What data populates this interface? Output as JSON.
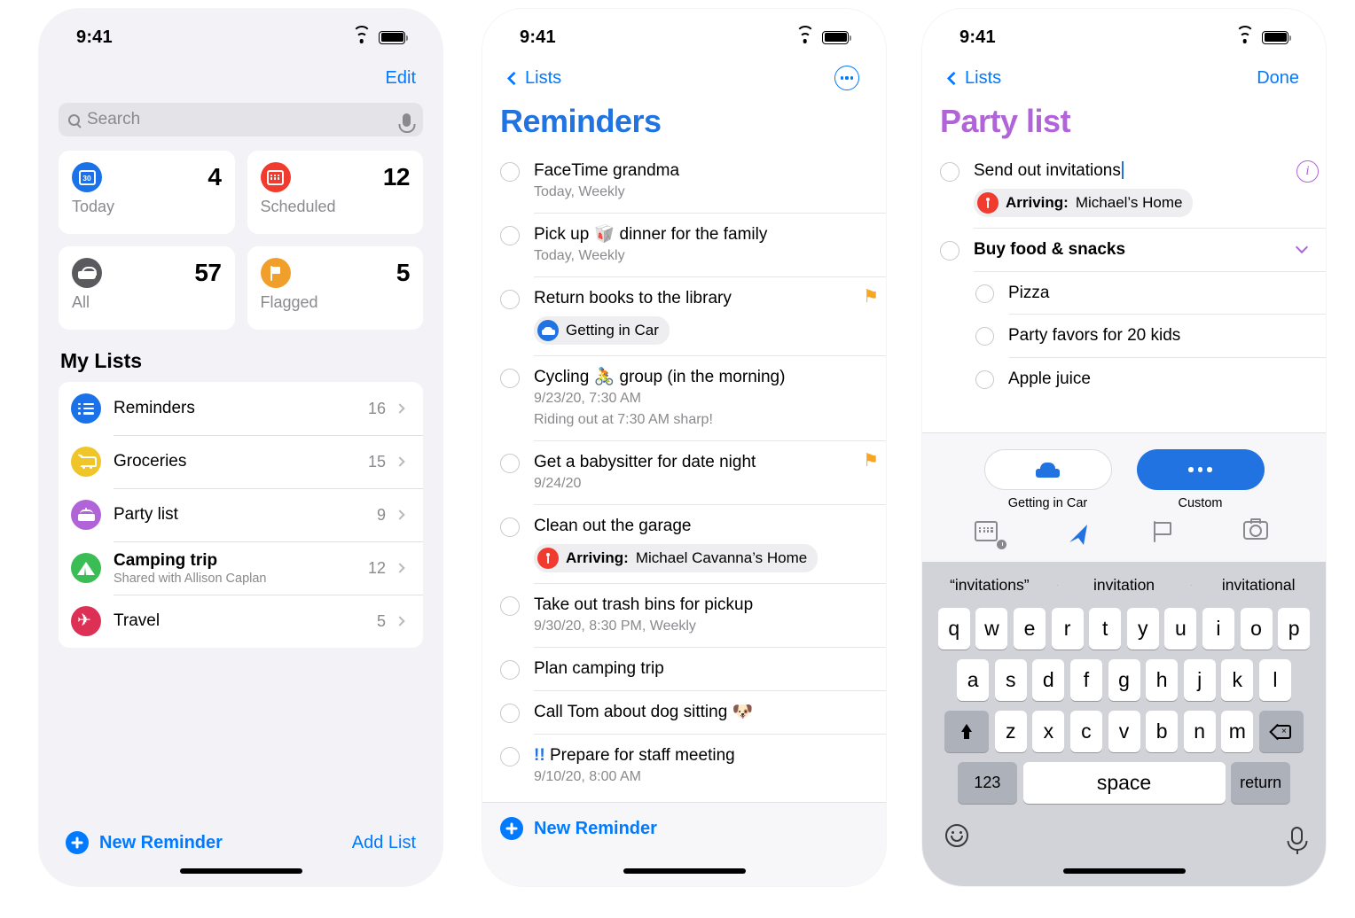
{
  "colors": {
    "accent_blue": "#007aff",
    "title_blue": "#2073e0",
    "purple": "#b163d8",
    "flag_orange": "#f5a623",
    "pin_red": "#f03b2e",
    "bg_grouped": "#f2f2f7",
    "keyboard_bg": "#d1d3d9"
  },
  "status_bar": {
    "time": "9:41",
    "wifi_icon": "wifi-icon",
    "battery_icon": "battery-icon"
  },
  "screen1": {
    "nav": {
      "edit_label": "Edit"
    },
    "search": {
      "placeholder": "Search",
      "search_icon": "search-icon",
      "mic_icon": "microphone-icon"
    },
    "smart_lists": [
      {
        "label": "Today",
        "count": "4",
        "icon": "calendar-day-icon",
        "color": "#1b72e8"
      },
      {
        "label": "Scheduled",
        "count": "12",
        "icon": "calendar-grid-icon",
        "color": "#f03b2e"
      },
      {
        "label": "All",
        "count": "57",
        "icon": "inbox-tray-icon",
        "color": "#59595e"
      },
      {
        "label": "Flagged",
        "count": "5",
        "icon": "flag-icon",
        "color": "#f0a02a"
      }
    ],
    "section_title": "My Lists",
    "lists": [
      {
        "title": "Reminders",
        "subtitle": "",
        "count": "16",
        "icon": "list-bullets-icon",
        "color": "#1b72e8"
      },
      {
        "title": "Groceries",
        "subtitle": "",
        "count": "15",
        "icon": "shopping-cart-icon",
        "color": "#f0c52a"
      },
      {
        "title": "Party list",
        "subtitle": "",
        "count": "9",
        "icon": "birthday-cake-icon",
        "color": "#b163d8"
      },
      {
        "title": "Camping trip",
        "subtitle": "Shared with Allison Caplan",
        "count": "12",
        "icon": "tent-icon",
        "color": "#3bbd55"
      },
      {
        "title": "Travel",
        "subtitle": "",
        "count": "5",
        "icon": "airplane-icon",
        "color": "#dc3055"
      }
    ],
    "toolbar": {
      "new_reminder": "New Reminder",
      "add_list": "Add List",
      "plus_icon": "plus-circle-icon"
    }
  },
  "screen2": {
    "nav": {
      "back_label": "Lists",
      "back_icon": "chevron-left-icon",
      "more_icon": "ellipsis-circle-icon"
    },
    "title": "Reminders",
    "reminders": [
      {
        "title": "FaceTime grandma",
        "meta": "Today, Weekly",
        "note": "",
        "flag": false,
        "chip": null
      },
      {
        "title": "Pick up 🥡 dinner for the family",
        "meta": "Today, Weekly",
        "note": "",
        "flag": false,
        "chip": null
      },
      {
        "title": "Return books to the library",
        "meta": "",
        "note": "",
        "flag": true,
        "chip": {
          "icon": "car-icon",
          "icon_style": "car",
          "prefix": "",
          "text": "Getting in Car"
        }
      },
      {
        "title": "Cycling 🚴 group (in the morning)",
        "meta": "9/23/20, 7:30 AM",
        "note": "Riding out at 7:30 AM sharp!",
        "flag": false,
        "chip": null
      },
      {
        "title": "Get a babysitter for date night",
        "meta": "9/24/20",
        "note": "",
        "flag": true,
        "chip": null
      },
      {
        "title": "Clean out the garage",
        "meta": "",
        "note": "",
        "flag": false,
        "chip": {
          "icon": "location-pin-icon",
          "icon_style": "pin",
          "prefix": "Arriving:",
          "text": "Michael Cavanna’s Home"
        }
      },
      {
        "title": "Take out trash bins for pickup",
        "meta": "9/30/20, 8:30 PM, Weekly",
        "note": "",
        "flag": false,
        "chip": null
      },
      {
        "title": "Plan camping trip",
        "meta": "",
        "note": "",
        "flag": false,
        "chip": null
      },
      {
        "title": "Call Tom about dog sitting 🐶",
        "meta": "",
        "note": "",
        "flag": false,
        "chip": null
      },
      {
        "title": "Prepare for staff meeting",
        "meta": "9/10/20, 8:00 AM",
        "note": "",
        "flag": false,
        "priority": "!!",
        "chip": null
      }
    ],
    "footer": {
      "new_reminder": "New Reminder",
      "plus_icon": "plus-circle-icon"
    }
  },
  "screen3": {
    "nav": {
      "back_label": "Lists",
      "back_icon": "chevron-left-icon",
      "done_label": "Done"
    },
    "title": "Party list",
    "items": [
      {
        "title": "Send out invitations",
        "editing": true,
        "bold": false,
        "sub": false,
        "info_icon": "info-circle-icon",
        "chip": {
          "icon": "location-pin-icon",
          "prefix": "Arriving:",
          "text": "Michael’s Home"
        }
      },
      {
        "title": "Buy food & snacks",
        "editing": false,
        "bold": true,
        "sub": false,
        "caret_icon": "chevron-down-icon",
        "chip": null
      },
      {
        "title": "Pizza",
        "editing": false,
        "bold": false,
        "sub": true,
        "chip": null
      },
      {
        "title": "Party favors for 20 kids",
        "editing": false,
        "bold": false,
        "sub": true,
        "chip": null
      },
      {
        "title": "Apple juice",
        "editing": false,
        "bold": false,
        "sub": true,
        "chip": null
      }
    ],
    "quick_actions": {
      "pills": [
        {
          "label": "Getting in Car",
          "style": "outline",
          "icon": "car-icon"
        },
        {
          "label": "Custom",
          "style": "filled",
          "icon": "ellipsis-icon"
        }
      ],
      "icons": [
        {
          "name": "calendar-clock-icon"
        },
        {
          "name": "location-arrow-icon"
        },
        {
          "name": "flag-outline-icon"
        },
        {
          "name": "camera-icon"
        }
      ]
    },
    "keyboard": {
      "predictions": [
        "“invitations”",
        "invitation",
        "invitational"
      ],
      "row1": [
        "q",
        "w",
        "e",
        "r",
        "t",
        "y",
        "u",
        "i",
        "o",
        "p"
      ],
      "row2": [
        "a",
        "s",
        "d",
        "f",
        "g",
        "h",
        "j",
        "k",
        "l"
      ],
      "row3": [
        "z",
        "x",
        "c",
        "v",
        "b",
        "n",
        "m"
      ],
      "shift_icon": "shift-icon",
      "backspace_icon": "backspace-icon",
      "numbers_label": "123",
      "space_label": "space",
      "return_label": "return",
      "emoji_icon": "emoji-icon",
      "dictation_icon": "microphone-icon"
    }
  }
}
